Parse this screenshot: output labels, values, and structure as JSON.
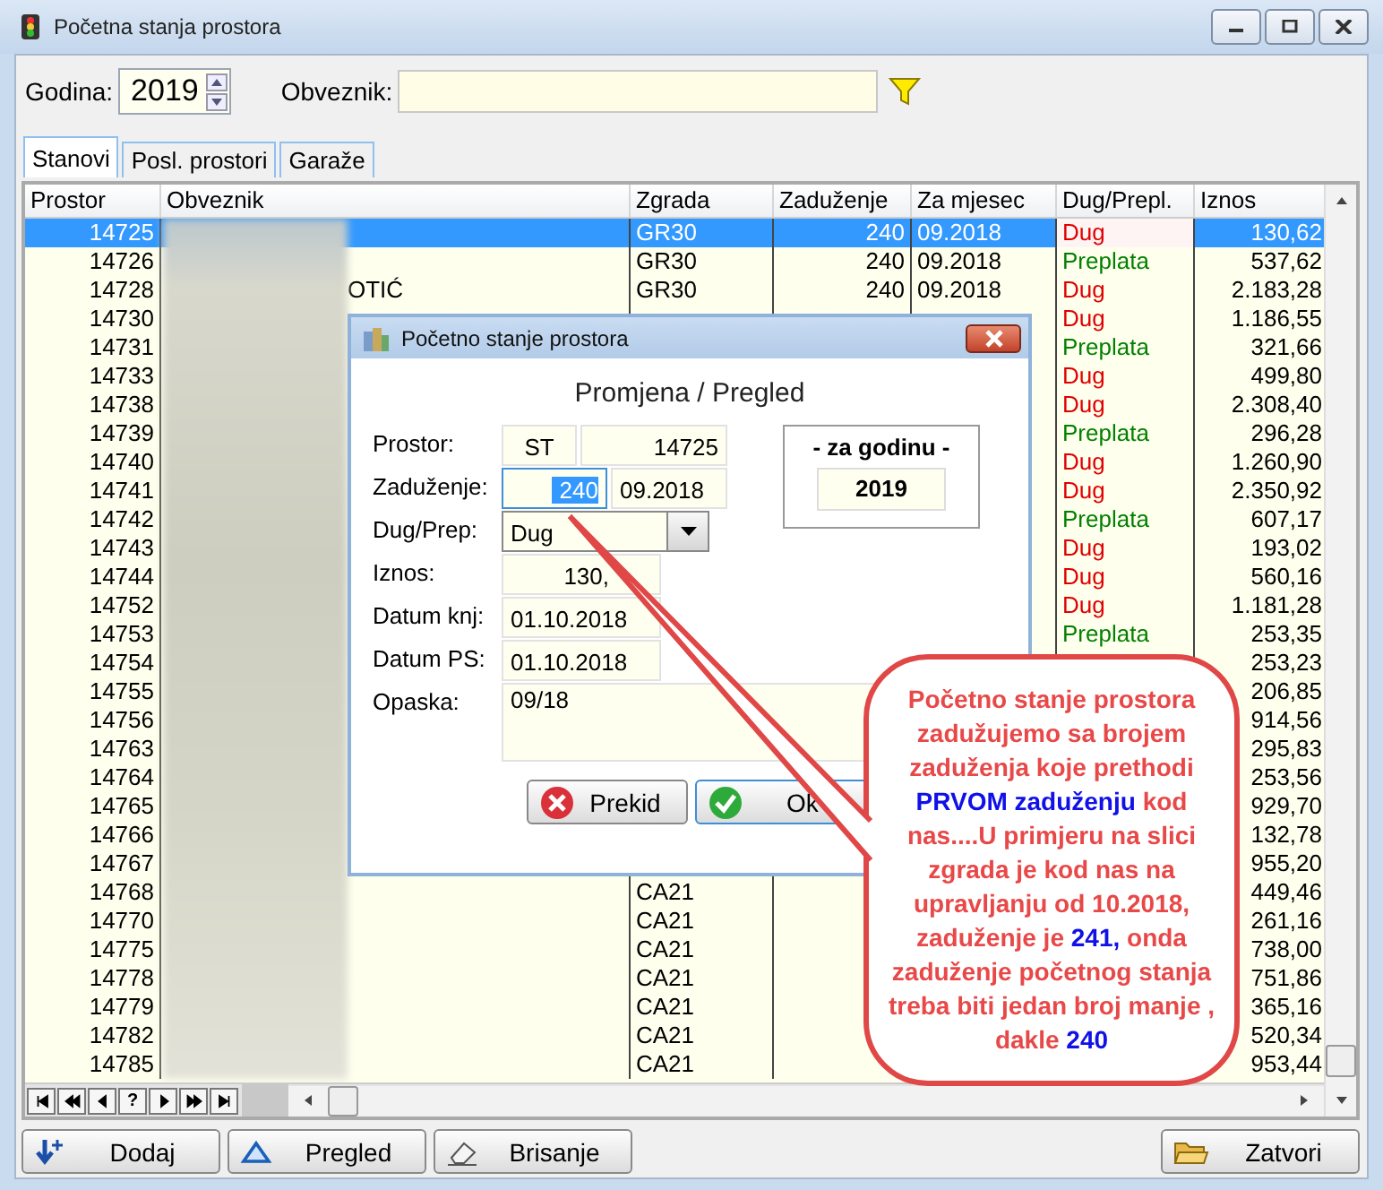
{
  "window": {
    "title": "Početna stanja prostora"
  },
  "filters": {
    "godina_label": "Godina:",
    "godina": "2019",
    "obveznik_label": "Obveznik:"
  },
  "tabs": [
    {
      "label": "Stanovi",
      "selected": true
    },
    {
      "label": "Posl. prostori",
      "selected": false
    },
    {
      "label": "Garaže",
      "selected": false
    }
  ],
  "table": {
    "columns": [
      "Prostor",
      "Obveznik",
      "Zgrada",
      "Zaduženje",
      "Za mjesec",
      "Dug/Prepl.",
      "Iznos"
    ],
    "rows": [
      {
        "prostor": "14725",
        "zgrada": "GR30",
        "zaduzenje": "240",
        "za_mjesec": "09.2018",
        "dug_prepl": "Dug",
        "color": "#e00000",
        "iznos": "130,62",
        "selected": true
      },
      {
        "prostor": "14726",
        "zgrada": "GR30",
        "zaduzenje": "240",
        "za_mjesec": "09.2018",
        "dug_prepl": "Preplata",
        "color": "#008000",
        "iznos": "537,62",
        "selected": false
      },
      {
        "prostor": "14728",
        "obveznik": "OTIĆ",
        "zgrada": "GR30",
        "zaduzenje": "240",
        "za_mjesec": "09.2018",
        "dug_prepl": "Dug",
        "color": "#e00000",
        "iznos": "2.183,28",
        "selected": false
      },
      {
        "prostor": "14730",
        "dug_prepl": "Dug",
        "color": "#e00000",
        "iznos": "1.186,55",
        "selected": false
      },
      {
        "prostor": "14731",
        "dug_prepl": "Preplata",
        "color": "#008000",
        "iznos": "321,66",
        "selected": false
      },
      {
        "prostor": "14733",
        "dug_prepl": "Dug",
        "color": "#e00000",
        "iznos": "499,80",
        "selected": false
      },
      {
        "prostor": "14738",
        "dug_prepl": "Dug",
        "color": "#e00000",
        "iznos": "2.308,40",
        "selected": false
      },
      {
        "prostor": "14739",
        "dug_prepl": "Preplata",
        "color": "#008000",
        "iznos": "296,28",
        "selected": false
      },
      {
        "prostor": "14740",
        "dug_prepl": "Dug",
        "color": "#e00000",
        "iznos": "1.260,90",
        "selected": false
      },
      {
        "prostor": "14741",
        "dug_prepl": "Dug",
        "color": "#e00000",
        "iznos": "2.350,92",
        "selected": false
      },
      {
        "prostor": "14742",
        "dug_prepl": "Preplata",
        "color": "#008000",
        "iznos": "607,17",
        "selected": false
      },
      {
        "prostor": "14743",
        "dug_prepl": "Dug",
        "color": "#e00000",
        "iznos": "193,02",
        "selected": false
      },
      {
        "prostor": "14744",
        "dug_prepl": "Dug",
        "color": "#e00000",
        "iznos": "560,16",
        "selected": false
      },
      {
        "prostor": "14752",
        "dug_prepl": "Dug",
        "color": "#e00000",
        "iznos": "1.181,28",
        "selected": false
      },
      {
        "prostor": "14753",
        "dug_prepl": "Preplata",
        "color": "#008000",
        "iznos": "253,35",
        "selected": false
      },
      {
        "prostor": "14754",
        "iznos": "253,23",
        "selected": false
      },
      {
        "prostor": "14755",
        "iznos": "206,85",
        "selected": false
      },
      {
        "prostor": "14756",
        "iznos": "914,56",
        "selected": false
      },
      {
        "prostor": "14763",
        "iznos": "295,83",
        "selected": false
      },
      {
        "prostor": "14764",
        "iznos": "253,56",
        "selected": false
      },
      {
        "prostor": "14765",
        "iznos": "929,70",
        "selected": false
      },
      {
        "prostor": "14766",
        "iznos": "132,78",
        "selected": false
      },
      {
        "prostor": "14767",
        "iznos": "955,20",
        "selected": false
      },
      {
        "prostor": "14768",
        "zgrada": "CA21",
        "iznos": "449,46",
        "selected": false
      },
      {
        "prostor": "14770",
        "zgrada": "CA21",
        "iznos": "261,16",
        "selected": false
      },
      {
        "prostor": "14775",
        "zgrada": "CA21",
        "iznos": "738,00",
        "selected": false
      },
      {
        "prostor": "14778",
        "zgrada": "CA21",
        "iznos": "751,86",
        "selected": false
      },
      {
        "prostor": "14779",
        "zgrada": "CA21",
        "iznos": "365,16",
        "selected": false
      },
      {
        "prostor": "14782",
        "zgrada": "CA21",
        "iznos": "520,34",
        "selected": false
      },
      {
        "prostor": "14785",
        "zgrada": "CA21",
        "iznos": "953,44",
        "selected": false
      }
    ]
  },
  "navigator": [
    {
      "kind": "first"
    },
    {
      "kind": "prev-page"
    },
    {
      "kind": "prev"
    },
    {
      "kind": "text",
      "label": "?"
    },
    {
      "kind": "next"
    },
    {
      "kind": "next-page"
    },
    {
      "kind": "last"
    }
  ],
  "buttons": [
    {
      "kind": "add",
      "label": "Dodaj"
    },
    {
      "kind": "view",
      "label": "Pregled"
    },
    {
      "kind": "erase",
      "label": "Brisanje"
    },
    {
      "kind": "close",
      "label": "Zatvori"
    }
  ],
  "dialog": {
    "title": "Početno stanje prostora",
    "heading": "Promjena / Pregled",
    "prostor_label": "Prostor:",
    "prostor_type": "ST",
    "prostor": "14725",
    "zaduzenje_label": "Zaduženje:",
    "zaduzenje": "240",
    "za_mjesec": "09.2018",
    "dug_label": "Dug/Prep:",
    "dug": "Dug",
    "iznos_label": "Iznos:",
    "iznos": "130,",
    "datum_knj_label": "Datum knj:",
    "datum_knj": "01.10.2018",
    "datum_ps_label": "Datum PS:",
    "datum_ps": "01.10.2018",
    "opaska_label": "Opaska:",
    "opaska": "09/18",
    "year_title": "- za godinu -",
    "year": "2019",
    "cancel": "Prekid",
    "ok": "Ok"
  },
  "callout": {
    "text": "Početno stanje prostora zadužujemo sa brojem zaduženja koje prethodi **PRVOM zaduženju** kod nas....U primjeru na slici zgrada je kod nas na upravljanju od 10.2018, zaduženje je **241,** onda zaduženje početnog stanja treba biti jedan broj manje , dakle **240**"
  }
}
